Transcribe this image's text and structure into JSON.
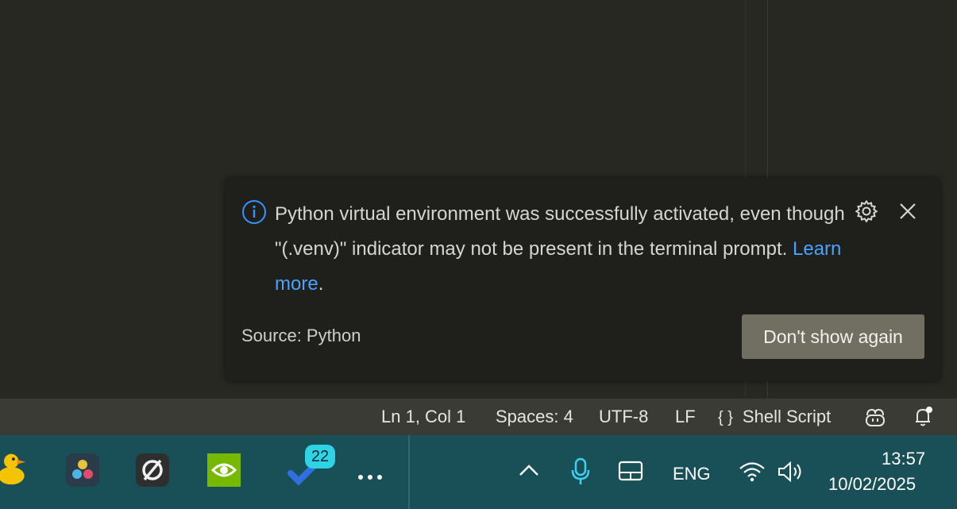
{
  "notification": {
    "message": "Python virtual environment was successfully activated, even though \"(.venv)\" indicator may not be present in the terminal prompt.",
    "link_text": "Learn more",
    "link_suffix": ".",
    "source": "Source: Python",
    "button_label": "Don't show again",
    "icons": {
      "info": "info-icon",
      "settings": "gear-icon",
      "close": "close-icon"
    }
  },
  "statusbar": {
    "cursor": "Ln 1, Col 1",
    "indent": "Spaces: 4",
    "encoding": "UTF-8",
    "eol": "LF",
    "language_icon": "{ }",
    "language": "Shell Script",
    "icons": {
      "copilot": "copilot-icon",
      "notifications": "bell-icon"
    }
  },
  "taskbar": {
    "apps": [
      "duck-app-icon",
      "davinci-resolve-icon",
      "obsidian-like-icon",
      "nvidia-icon",
      "todo-icon"
    ],
    "badge": "22",
    "more": "more-icon",
    "tray": {
      "language": "ENG",
      "time": "13:57",
      "date": "10/02/2025"
    }
  },
  "colors": {
    "editor_bg": "#272822",
    "status_bg": "#3b3b35",
    "taskbar_bg": "#194f56",
    "accent_link": "#4aa3ff",
    "button_bg": "#716e62",
    "badge_bg": "#2ed3e6"
  }
}
